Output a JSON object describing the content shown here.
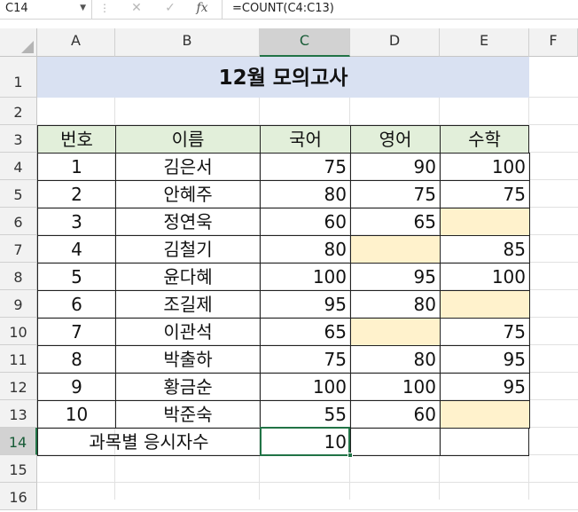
{
  "formula_bar": {
    "name_box": "C14",
    "cancel_icon": "✕",
    "enter_icon": "✓",
    "fx_label": "fx",
    "formula": "=COUNT(C4:C13)"
  },
  "columns": [
    "A",
    "B",
    "C",
    "D",
    "E",
    "F"
  ],
  "rows": [
    "1",
    "2",
    "3",
    "4",
    "5",
    "6",
    "7",
    "8",
    "9",
    "10",
    "11",
    "12",
    "13",
    "14",
    "15",
    "16"
  ],
  "sheet": {
    "title": "12월 모의고사",
    "headers": [
      "번호",
      "이름",
      "국어",
      "영어",
      "수학"
    ],
    "students": [
      {
        "no": "1",
        "name": "김은서",
        "kor": "75",
        "eng": "90",
        "math": "100"
      },
      {
        "no": "2",
        "name": "안혜주",
        "kor": "80",
        "eng": "75",
        "math": "75"
      },
      {
        "no": "3",
        "name": "정연욱",
        "kor": "60",
        "eng": "65",
        "math": ""
      },
      {
        "no": "4",
        "name": "김철기",
        "kor": "80",
        "eng": "",
        "math": "85"
      },
      {
        "no": "5",
        "name": "윤다혜",
        "kor": "100",
        "eng": "95",
        "math": "100"
      },
      {
        "no": "6",
        "name": "조길제",
        "kor": "95",
        "eng": "80",
        "math": ""
      },
      {
        "no": "7",
        "name": "이관석",
        "kor": "65",
        "eng": "",
        "math": "75"
      },
      {
        "no": "8",
        "name": "박출하",
        "kor": "75",
        "eng": "80",
        "math": "95"
      },
      {
        "no": "9",
        "name": "황금순",
        "kor": "100",
        "eng": "100",
        "math": "95"
      },
      {
        "no": "10",
        "name": "박준숙",
        "kor": "55",
        "eng": "60",
        "math": ""
      }
    ],
    "summary_label": "과목별 응시자수",
    "summary_value": "10"
  },
  "colors": {
    "title_fill": "#d9e1f2",
    "header_fill": "#e2efda",
    "blank_fill": "#fff2cc",
    "selection": "#217346"
  }
}
